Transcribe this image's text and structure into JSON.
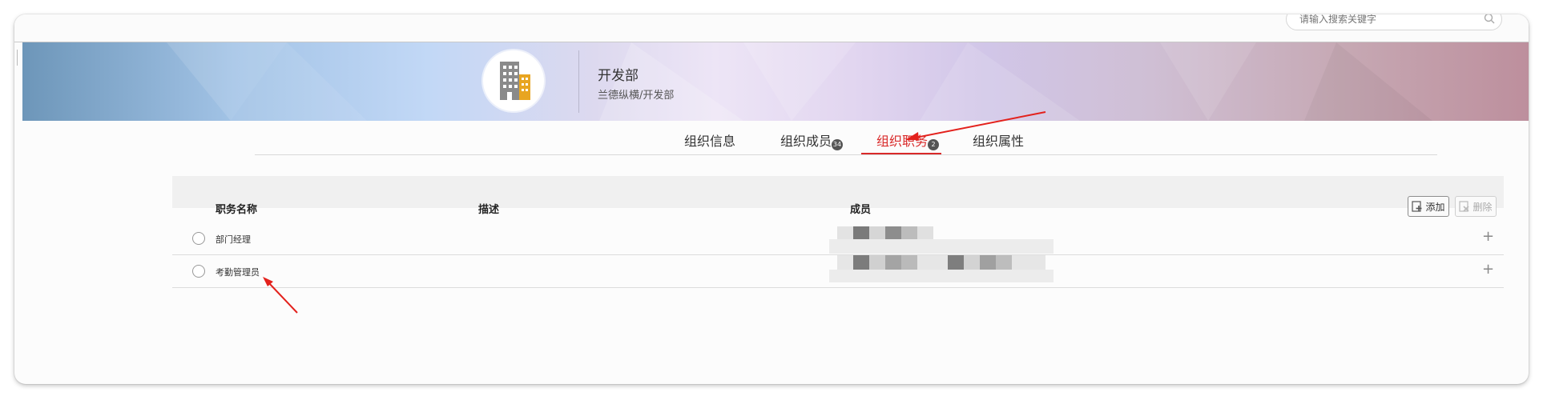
{
  "search": {
    "placeholder": "请输入搜索关键字"
  },
  "org": {
    "name": "开发部",
    "path": "兰德纵横/开发部"
  },
  "tabs": [
    {
      "label": "组织信息",
      "badge": ""
    },
    {
      "label": "组织成员",
      "badge": "34"
    },
    {
      "label": "组织职务",
      "badge": "2",
      "active": true
    },
    {
      "label": "组织属性",
      "badge": ""
    }
  ],
  "table": {
    "headers": {
      "name": "职务名称",
      "desc": "描述",
      "members": "成员"
    },
    "add_label": "添加",
    "delete_label": "删除",
    "rows": [
      {
        "name": "部门经理",
        "desc": ""
      },
      {
        "name": "考勤管理员",
        "desc": ""
      }
    ]
  },
  "colors": {
    "accent": "#d92a2a",
    "header_bg": "#f0f0f0"
  }
}
